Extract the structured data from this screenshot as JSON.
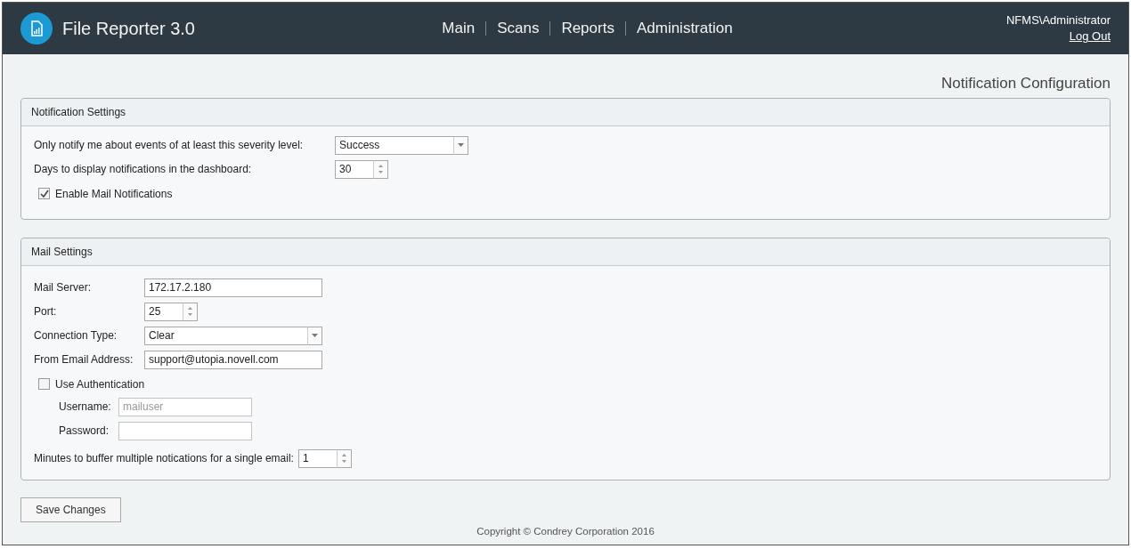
{
  "header": {
    "app_title": "File Reporter 3.0",
    "nav": [
      {
        "label": "Main",
        "selected": false
      },
      {
        "label": "Scans",
        "selected": false
      },
      {
        "label": "Reports",
        "selected": false
      },
      {
        "label": "Administration",
        "selected": false
      }
    ],
    "user": "NFMS\\Administrator",
    "logout": "Log Out"
  },
  "page_title": "Notification Configuration",
  "notification_settings": {
    "title": "Notification Settings",
    "fields": [
      {
        "kind": "select",
        "label": "Only notify me about events of at least this severity level:",
        "value": "Success"
      },
      {
        "kind": "number",
        "label": "Days to display notifications in the dashboard:",
        "value": "30"
      }
    ],
    "checkbox": {
      "label": "Enable Mail Notifications",
      "checked": true
    }
  },
  "mail_settings": {
    "title": "Mail Settings",
    "fields": [
      {
        "kind": "text",
        "label": "Mail Server:",
        "value": "172.17.2.180"
      },
      {
        "kind": "number",
        "label": "Port:",
        "value": "25"
      },
      {
        "kind": "select",
        "label": "Connection Type:",
        "value": "Clear"
      },
      {
        "kind": "text",
        "label": "From Email Address:",
        "value": "support@utopia.novell.com"
      }
    ],
    "auth": {
      "label": "Use Authentication",
      "checked": false
    },
    "auth_fields": [
      {
        "label": "Username:",
        "value": "mailuser",
        "disabled": true
      },
      {
        "label": "Password:",
        "disabled": true
      }
    ],
    "buffer": {
      "kind": "number",
      "label": "Minutes to buffer multiple notications for a single email:",
      "value": "1"
    }
  },
  "save_button": "Save Changes",
  "footer": "Copyright © Condrey Corporation 2016"
}
